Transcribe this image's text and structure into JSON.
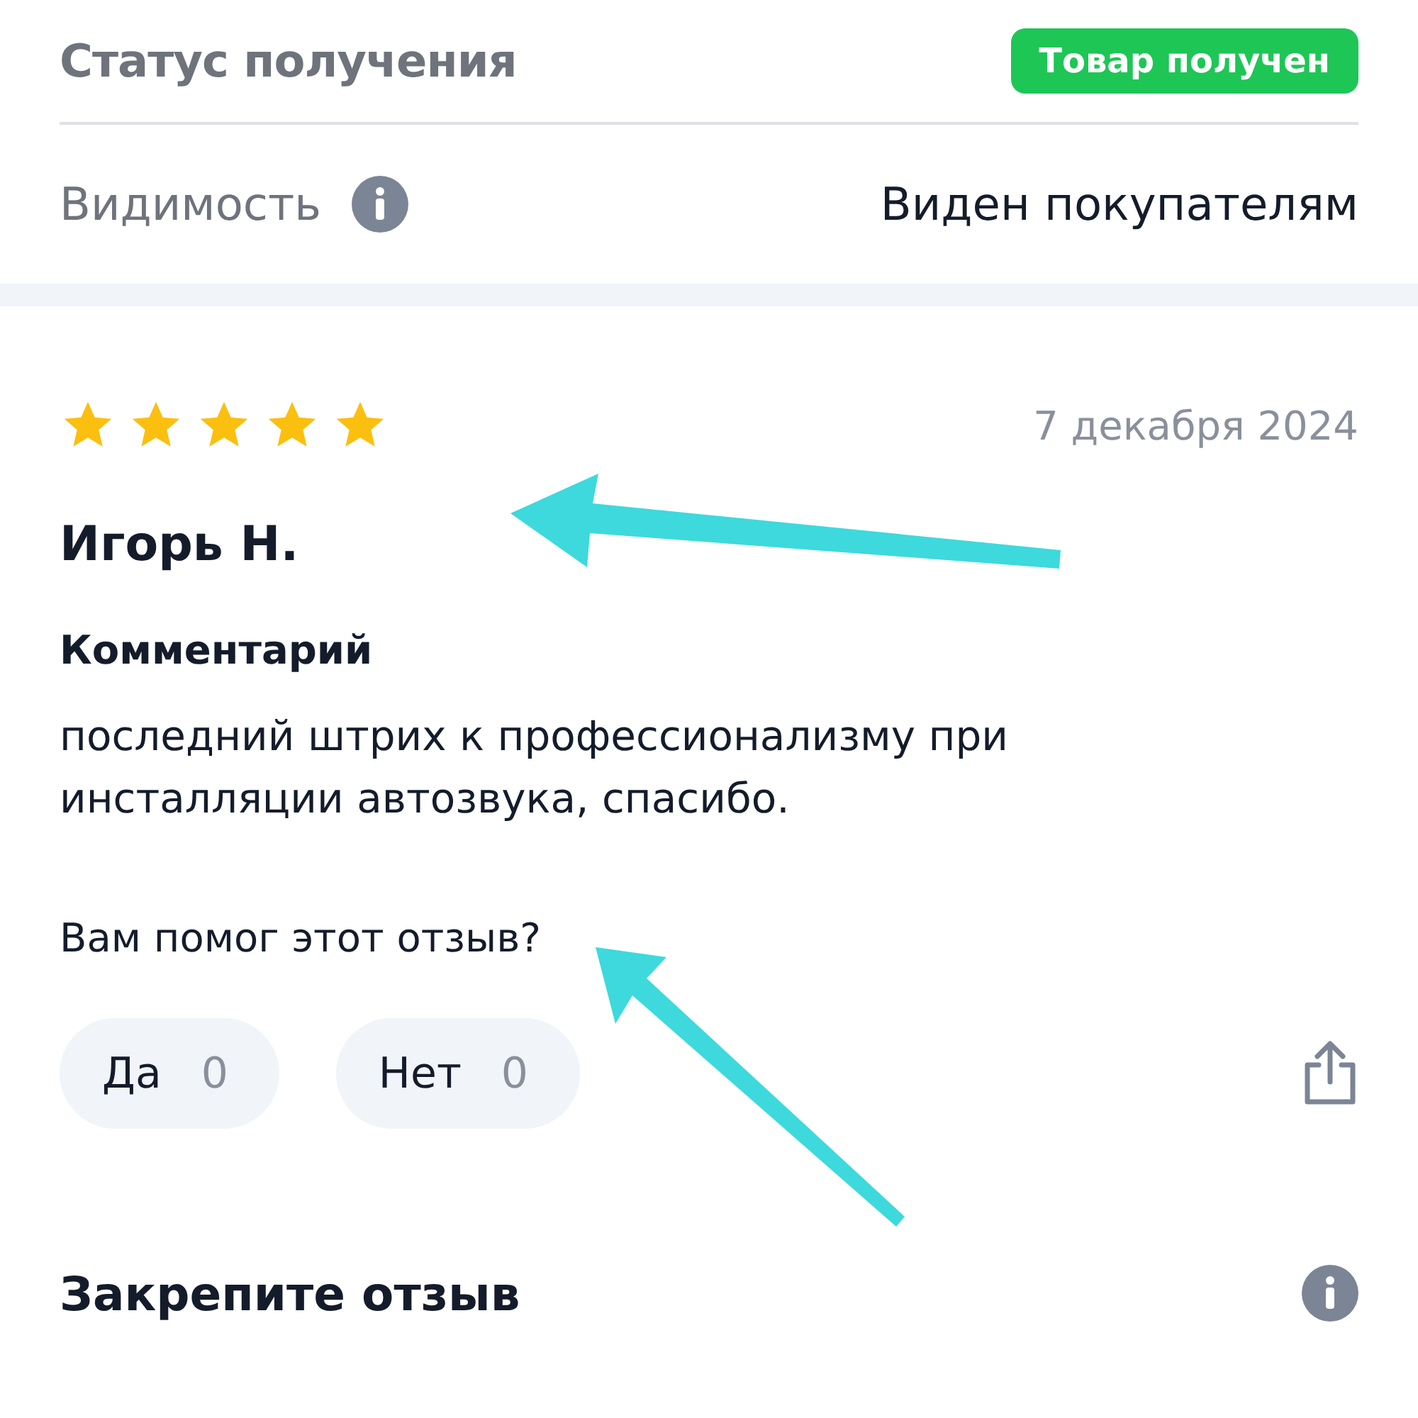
{
  "status": {
    "label": "Статус получения",
    "badge": "Товар получен"
  },
  "visibility": {
    "label": "Видимость",
    "value": "Виден покупателям"
  },
  "review": {
    "stars": 5,
    "date": "7 декабря 2024",
    "author": "Игорь Н.",
    "comment_title": "Комментарий",
    "comment": "последний штрих к профессионализму при инсталляции автозвука, спасибо.",
    "question": "Вам помог этот отзыв?",
    "votes": [
      {
        "label": "Да",
        "count": "0"
      },
      {
        "label": "Нет",
        "count": "0"
      }
    ]
  },
  "pin": {
    "title": "Закрепите отзыв"
  }
}
